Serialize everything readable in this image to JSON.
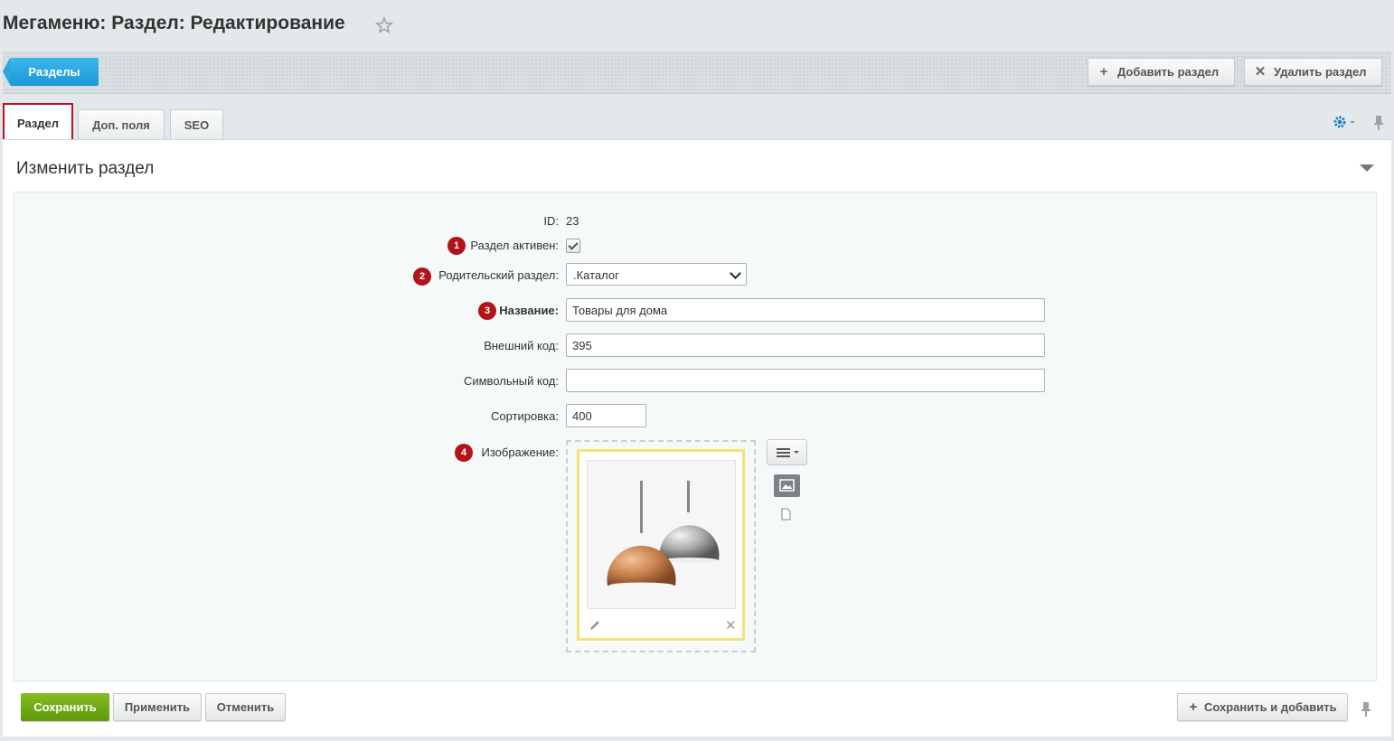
{
  "page": {
    "title": "Мегаменю: Раздел: Редактирование"
  },
  "toolbar": {
    "back_label": "Разделы",
    "add_label": "Добавить раздел",
    "delete_label": "Удалить раздел"
  },
  "tabs": [
    {
      "label": "Раздел",
      "active": true
    },
    {
      "label": "Доп. поля",
      "active": false
    },
    {
      "label": "SEO",
      "active": false
    }
  ],
  "section": {
    "title": "Изменить раздел"
  },
  "form": {
    "id_label": "ID:",
    "id_value": "23",
    "active_label": "Раздел активен:",
    "active_checked": true,
    "parent_label": "Родительский раздел:",
    "parent_value": ".Каталог",
    "name_label": "Название:",
    "name_value": "Товары для дома",
    "external_label": "Внешний код:",
    "external_value": "395",
    "symbolic_label": "Символьный код:",
    "symbolic_value": "",
    "sort_label": "Сортировка:",
    "sort_value": "400",
    "image_label": "Изображение:"
  },
  "markers": [
    "1",
    "2",
    "3",
    "4"
  ],
  "footer": {
    "save_label": "Сохранить",
    "apply_label": "Применить",
    "cancel_label": "Отменить",
    "save_add_label": "Сохранить и добавить"
  },
  "colors": {
    "accent_blue": "#1a9ad6",
    "save_green": "#6aa814",
    "marker_red": "#b0151a",
    "active_tab_border": "#c0102a"
  }
}
